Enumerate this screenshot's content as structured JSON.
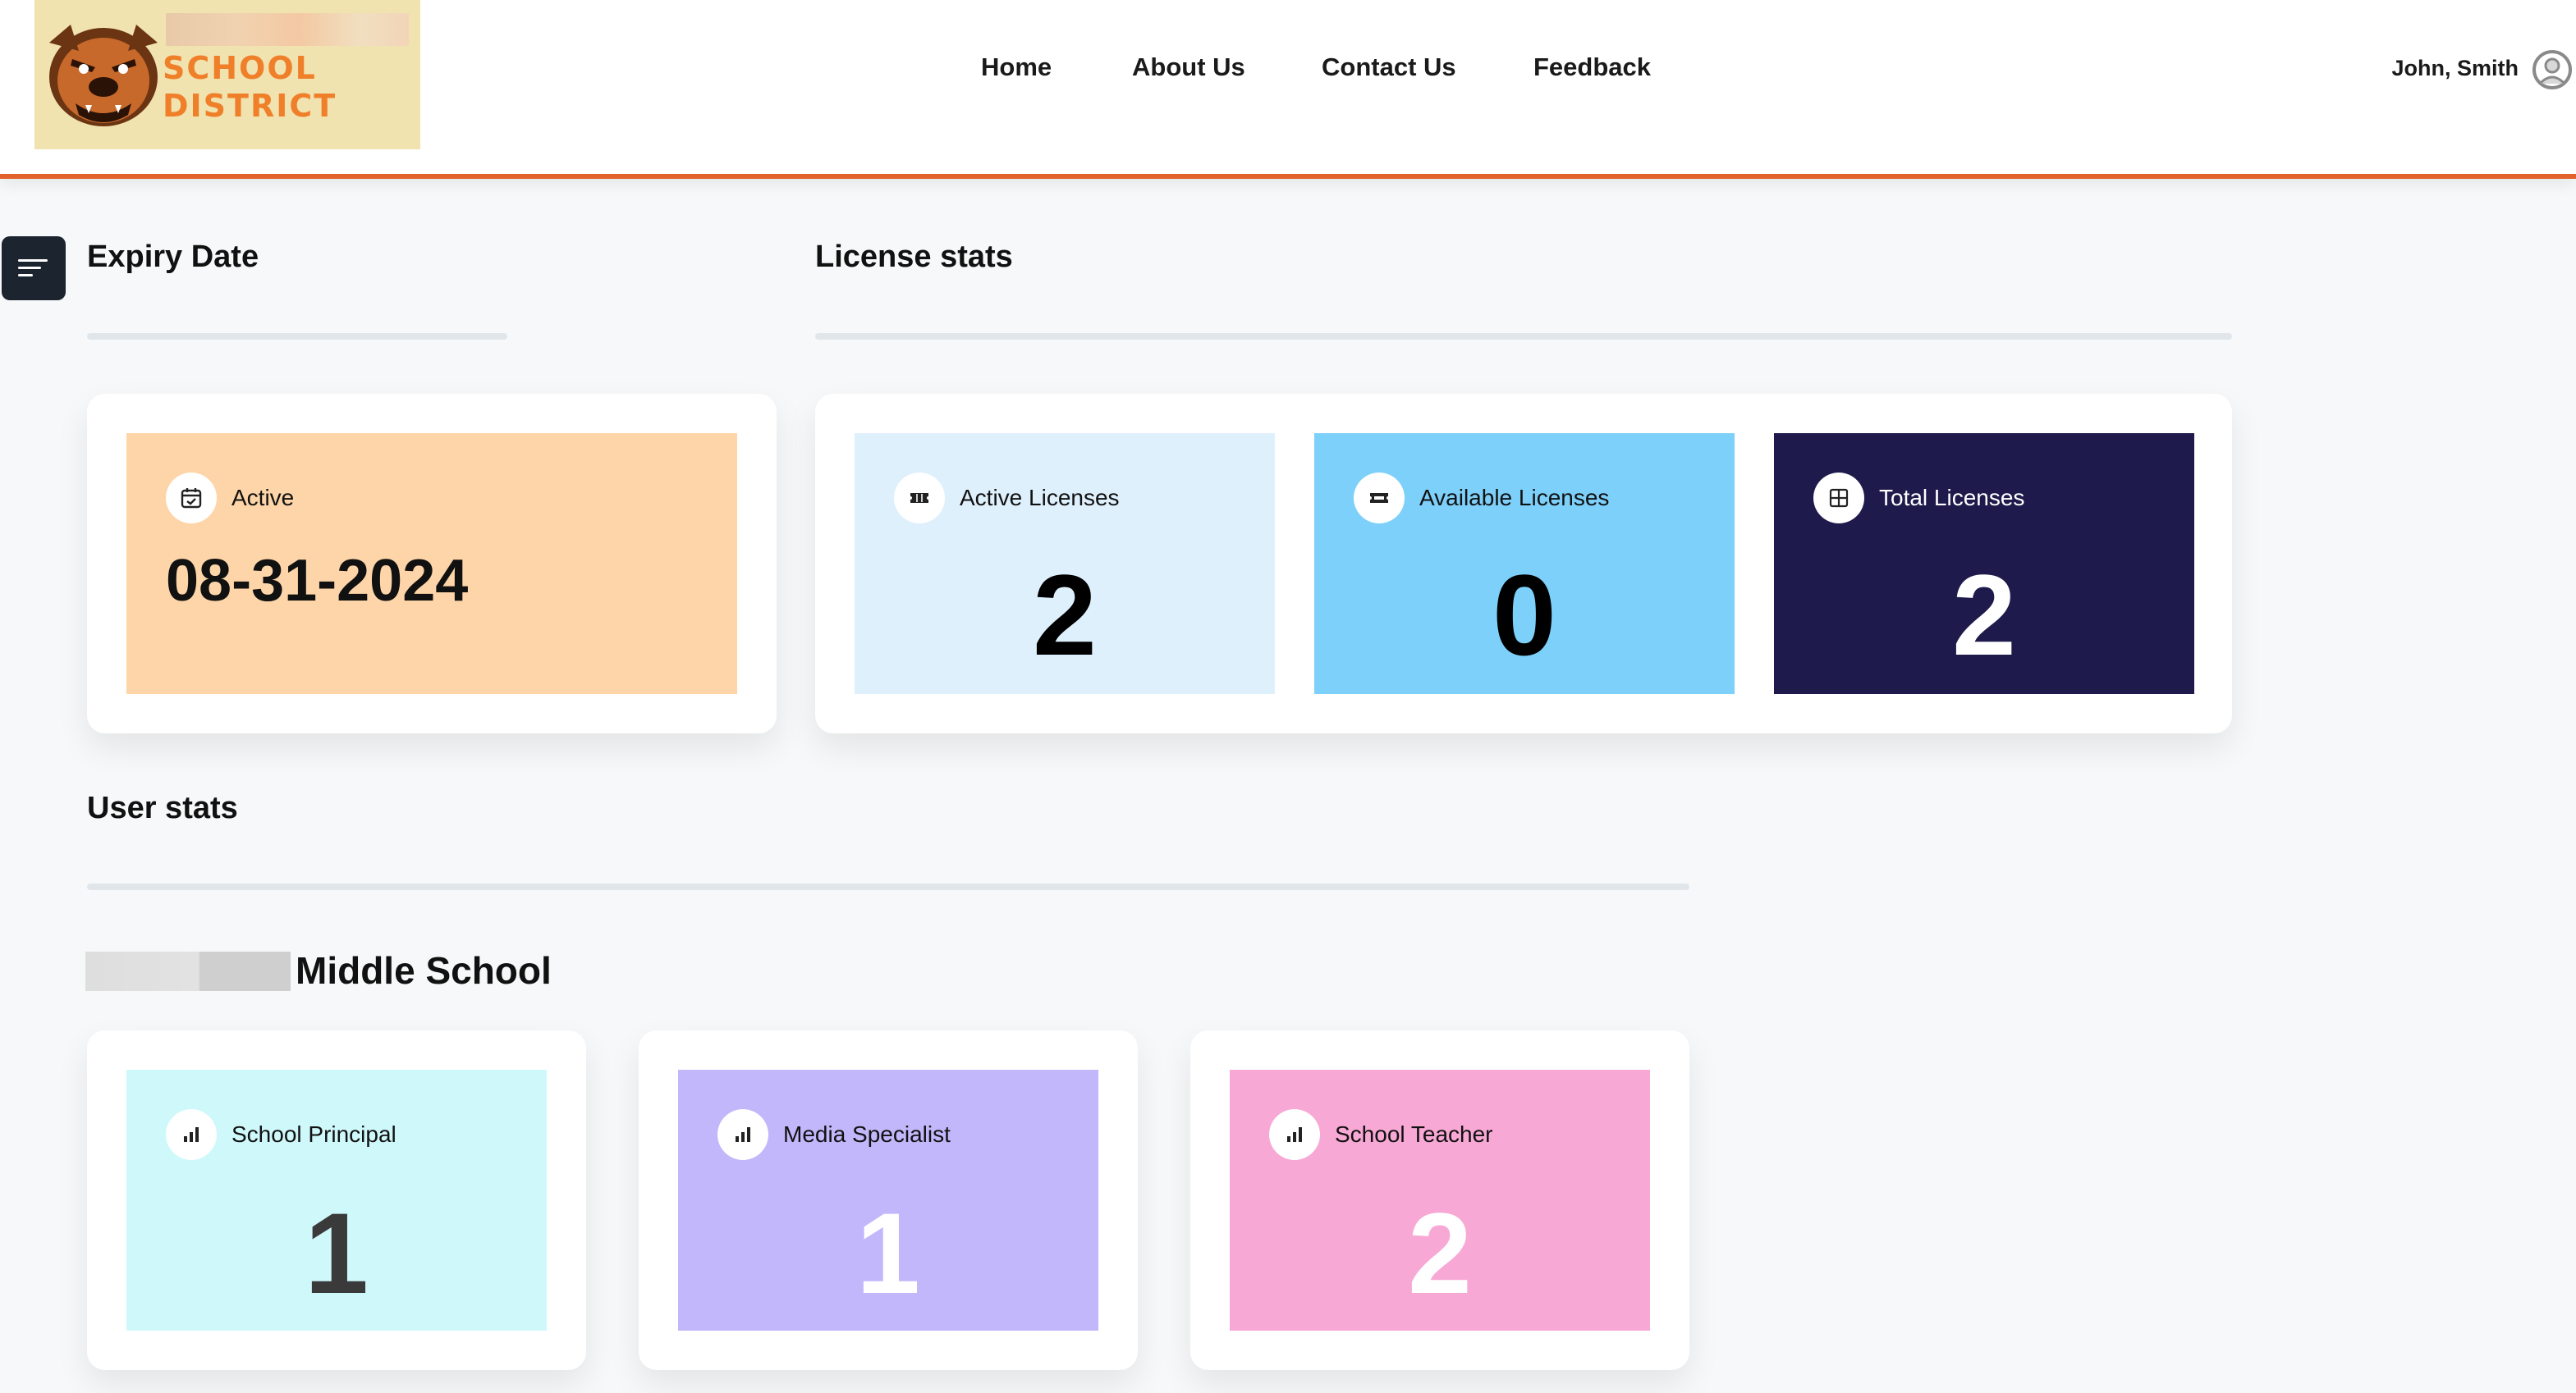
{
  "header": {
    "logo": {
      "line1": "SCHOOL",
      "line2": "DISTRICT",
      "accent_color": "#f07f2a",
      "background": "#f0e3b0",
      "icon": "bulldog-mascot-icon"
    },
    "nav": [
      {
        "label": "Home"
      },
      {
        "label": "About Us"
      },
      {
        "label": "Contact Us"
      },
      {
        "label": "Feedback"
      }
    ],
    "user": {
      "name": "John, Smith",
      "icon": "user-avatar-icon"
    },
    "border_color": "#e2622b"
  },
  "sidebar_toggle": {
    "icon": "menu-lines-icon"
  },
  "expiry": {
    "title": "Expiry Date",
    "status_label": "Active",
    "date": "08-31-2024",
    "icon": "calendar-check-icon",
    "card_color": "#fdd5a8"
  },
  "license_stats": {
    "title": "License stats",
    "cards": [
      {
        "label": "Active Licenses",
        "value": "2",
        "icon": "ticket-icon",
        "color": "#dff0fd",
        "text_color": "#000000"
      },
      {
        "label": "Available Licenses",
        "value": "0",
        "icon": "ticket-outline-icon",
        "color": "#7dd0fa",
        "text_color": "#000000"
      },
      {
        "label": "Total Licenses",
        "value": "2",
        "icon": "grid-icon",
        "color": "#1e1b4c",
        "text_color": "#ffffff"
      }
    ]
  },
  "user_stats": {
    "title": "User stats",
    "school_name": "Middle School",
    "cards": [
      {
        "label": "School Principal",
        "value": "1",
        "icon": "bar-chart-icon",
        "color": "#cff8fb",
        "value_color": "#3a3a3a"
      },
      {
        "label": "Media Specialist",
        "value": "1",
        "icon": "bar-chart-icon",
        "color": "#c2b7fb",
        "value_color": "#ffffff"
      },
      {
        "label": "School Teacher",
        "value": "2",
        "icon": "bar-chart-icon",
        "color": "#f8a8d5",
        "value_color": "#ffffff"
      }
    ]
  }
}
